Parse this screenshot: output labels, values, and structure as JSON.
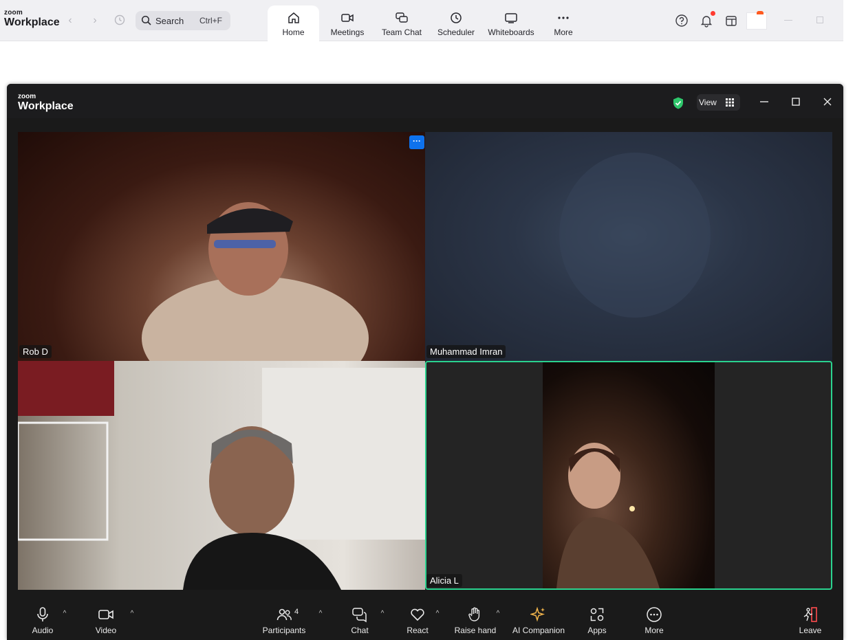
{
  "app": {
    "brand_small": "zoom",
    "brand_big": "Workplace",
    "search_label": "Search",
    "search_shortcut": "Ctrl+F",
    "tabs": [
      {
        "label": "Home",
        "icon": "home-icon"
      },
      {
        "label": "Meetings",
        "icon": "video-camera-icon"
      },
      {
        "label": "Team Chat",
        "icon": "chat-bubbles-icon"
      },
      {
        "label": "Scheduler",
        "icon": "clock-icon"
      },
      {
        "label": "Whiteboards",
        "icon": "whiteboard-icon"
      },
      {
        "label": "More",
        "icon": "ellipsis-icon"
      }
    ],
    "active_tab": "Home"
  },
  "meeting": {
    "brand_small": "zoom",
    "brand_big": "Workplace",
    "view_label": "View",
    "accent_color": "#2ad38f",
    "participants": [
      {
        "name": "Rob D"
      },
      {
        "name": "Muhammad Imran"
      },
      {
        "name": ""
      },
      {
        "name": "Alicia L",
        "active_speaker": true
      }
    ],
    "tile_menu": "···"
  },
  "toolbar": {
    "audio": "Audio",
    "video": "Video",
    "participants": "Participants",
    "participant_count": "4",
    "chat": "Chat",
    "react": "React",
    "raise_hand": "Raise hand",
    "ai_companion": "AI Companion",
    "apps": "Apps",
    "more": "More",
    "leave": "Leave"
  }
}
